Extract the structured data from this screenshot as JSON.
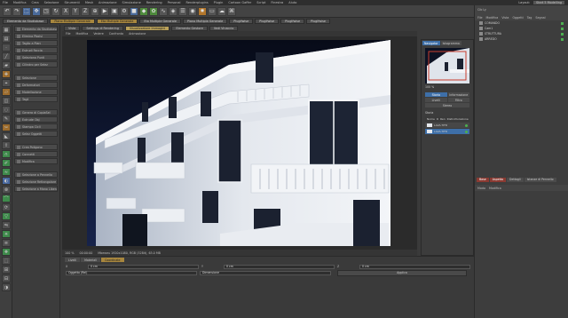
{
  "menubar": {
    "items": [
      "File",
      "Modifica",
      "Crea",
      "Selezione",
      "Strumenti",
      "Mesh",
      "Animazione",
      "Simulazione",
      "Rendering",
      "Personal",
      "Renderplugins",
      "Plugin",
      "Cartoon Gaffer",
      "Script",
      "Finestra",
      "Aiuto"
    ],
    "layout_label": "Layout:",
    "layout_value": "Start 5 Modelling"
  },
  "tabs": [
    "Elemento da Studiobase",
    "Piano Multiple Generale",
    "Eta Multiple Generale",
    "Eta Multiple Generale",
    "Piano Multipla Generale",
    "Pluglfwise",
    "Pluglfwise",
    "Pluglfwise",
    "Pluglfwise"
  ],
  "left_objects": {
    "group1": [
      "Elemento da Studiobase",
      "Elimina Pbolsi",
      "Taglio a Piani",
      "Estrudi Faccia",
      "Seleziona Punti",
      "Cilindro per Selez"
    ],
    "group2": [
      "Selezione",
      "Deformatori",
      "Modellazione",
      "Tagli"
    ],
    "group3": [
      "Genera di CopiaSel",
      "Extrude Obj",
      "Stampa Cicli",
      "Selez Oggetti"
    ],
    "group4": [
      "Crea Poligono",
      "Connetti",
      "Modifica"
    ],
    "group5": [
      "Selezione a Pennello",
      "Selezione Rettangolare",
      "Selezione a Mano Libera"
    ]
  },
  "viewport": {
    "tabs": [
      "Vista",
      "Settings di Rendering",
      "Visualizzatore Immagini",
      "Elemento Gestore",
      "Vedi Vinaccio"
    ],
    "menu": [
      "File",
      "Modifica",
      "Vedere",
      "Confronta",
      "Animazione"
    ],
    "status": [
      "100 %",
      "00:00:00",
      "Mbeweu 1920x1080, RGB (32Bit), 63.0 MB"
    ]
  },
  "navigator": {
    "tabs": [
      "Navigator",
      "Istogramma"
    ],
    "buttons": [
      "Storia",
      "Informazione",
      "Livelli",
      "Filtro",
      "Stereo"
    ],
    "history_label": "Storia",
    "history_cols": [
      "Nome",
      "R",
      "Ren",
      "Ristrutturazione"
    ],
    "history_rows": [
      "LAVA.TIFD",
      "LAVA.TIFD"
    ],
    "zoom": "100 %"
  },
  "right_panel": {
    "top_label": "Cib Ly",
    "menu": [
      "File",
      "Modifica",
      "Vista",
      "Oggetti",
      "Tag",
      "Segnal"
    ],
    "objects": [
      "COMANDO",
      "Cam1",
      "STRUTTURA",
      "ARREDO"
    ],
    "attr_tabs": [
      "Base",
      "Aspetto",
      "Dettagli",
      "Istanze di Pennello",
      "Modifica"
    ],
    "attr_menu": [
      "Modo",
      "Modifica"
    ]
  },
  "bottom_panel": {
    "tabs": [
      "Livelli",
      "Materiali",
      "Coordinate"
    ],
    "fields": [
      {
        "label": "X",
        "value": "0 cm"
      },
      {
        "label": "Y",
        "value": "0 cm"
      },
      {
        "label": "Z",
        "value": "0 cm"
      }
    ],
    "apply_label": "Applica",
    "mode_label": "Oggetto (Rel)",
    "size_label": "Dimensione"
  },
  "colors": {
    "accent_tab": "#a7863e",
    "selection_blue": "#3e6fa8",
    "building_white": "#e9edf2",
    "night_sky": "#0c1224"
  }
}
